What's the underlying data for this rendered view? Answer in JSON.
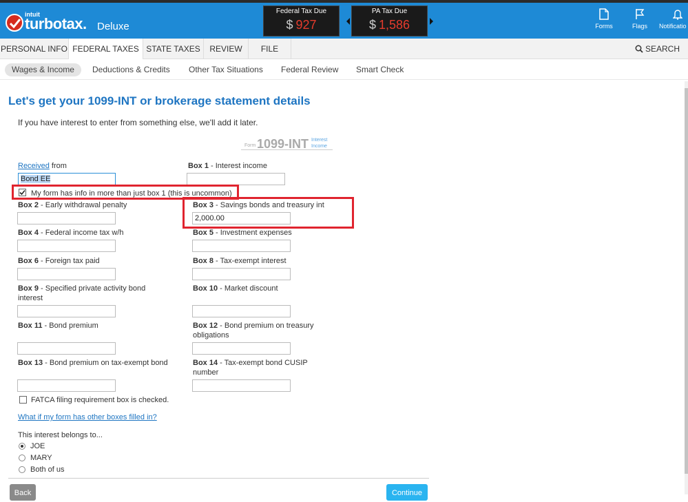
{
  "header": {
    "brand_small": "intuit",
    "brand": "turbotax.",
    "edition": "Deluxe",
    "federal_label": "Federal Tax Due",
    "federal_currency": "$",
    "federal_amount": "927",
    "state_label": "PA Tax Due",
    "state_currency": "$",
    "state_amount": "1,586",
    "icons": [
      {
        "label": "Forms",
        "icon": "document-icon"
      },
      {
        "label": "Flags",
        "icon": "flag-icon"
      },
      {
        "label": "Notificatio",
        "icon": "bell-icon"
      }
    ]
  },
  "nav": {
    "tabs": [
      "PERSONAL INFO",
      "FEDERAL TAXES",
      "STATE TAXES",
      "REVIEW",
      "FILE"
    ],
    "active_tab": "FEDERAL TAXES",
    "search_label": "SEARCH",
    "subtabs": [
      "Wages & Income",
      "Deductions & Credits",
      "Other Tax Situations",
      "Federal Review",
      "Smart Check"
    ]
  },
  "page": {
    "title": "Let's get your 1099-INT or brokerage statement details",
    "intro": "If you have interest to enter from something else, we'll add it later.",
    "form_badge": {
      "form_word": "Form",
      "form_number": "1099-INT",
      "form_type_1": "Interest",
      "form_type_2": "Income"
    }
  },
  "form": {
    "received_link": "Received",
    "received_suffix": " from",
    "payer_value": "Bond EE",
    "multi_box_label": "My form has info in more than just box 1 (this is uncommon)",
    "boxes": {
      "b1": {
        "num": "Box 1",
        "desc": " - Interest income",
        "value": ""
      },
      "b2": {
        "num": "Box 2",
        "desc": " - Early withdrawal penalty",
        "value": ""
      },
      "b3": {
        "num": "Box 3",
        "desc": " - Savings bonds and treasury int",
        "value": "2,000.00"
      },
      "b4": {
        "num": "Box 4",
        "desc": " - Federal income tax w/h",
        "value": ""
      },
      "b5": {
        "num": "Box 5",
        "desc": " - Investment expenses",
        "value": ""
      },
      "b6": {
        "num": "Box 6",
        "desc": " - Foreign tax paid",
        "value": ""
      },
      "b8": {
        "num": "Box 8",
        "desc": " - Tax-exempt interest",
        "value": ""
      },
      "b9": {
        "num": "Box 9",
        "desc": " - Specified private activity bond",
        "desc2": "interest",
        "value": ""
      },
      "b10": {
        "num": "Box 10",
        "desc": " - Market discount",
        "value": ""
      },
      "b11": {
        "num": "Box 11",
        "desc": " - Bond premium",
        "value": ""
      },
      "b12": {
        "num": "Box 12",
        "desc": " - Bond premium on treasury",
        "desc2": "obligations",
        "value": ""
      },
      "b13": {
        "num": "Box 13",
        "desc": " - Bond premium on tax-exempt bond",
        "value": ""
      },
      "b14": {
        "num": "Box 14",
        "desc": " - Tax-exempt bond CUSIP",
        "desc2": "number",
        "value": ""
      }
    },
    "fatca_label": "FATCA filing requirement box is checked.",
    "other_boxes_link": "What if my form has other boxes filled in?",
    "belongs_label": "This interest belongs to...",
    "owners": [
      "JOE",
      "MARY",
      "Both of us"
    ],
    "selected_owner": "JOE"
  },
  "buttons": {
    "back": "Back",
    "continue": "Continue"
  },
  "colors": {
    "header_blue": "#1e8ad6",
    "accent": "#1e75c2",
    "tax_red": "#e53b2c",
    "highlight_red": "#e0242f",
    "continue_blue": "#2ab4f0"
  }
}
